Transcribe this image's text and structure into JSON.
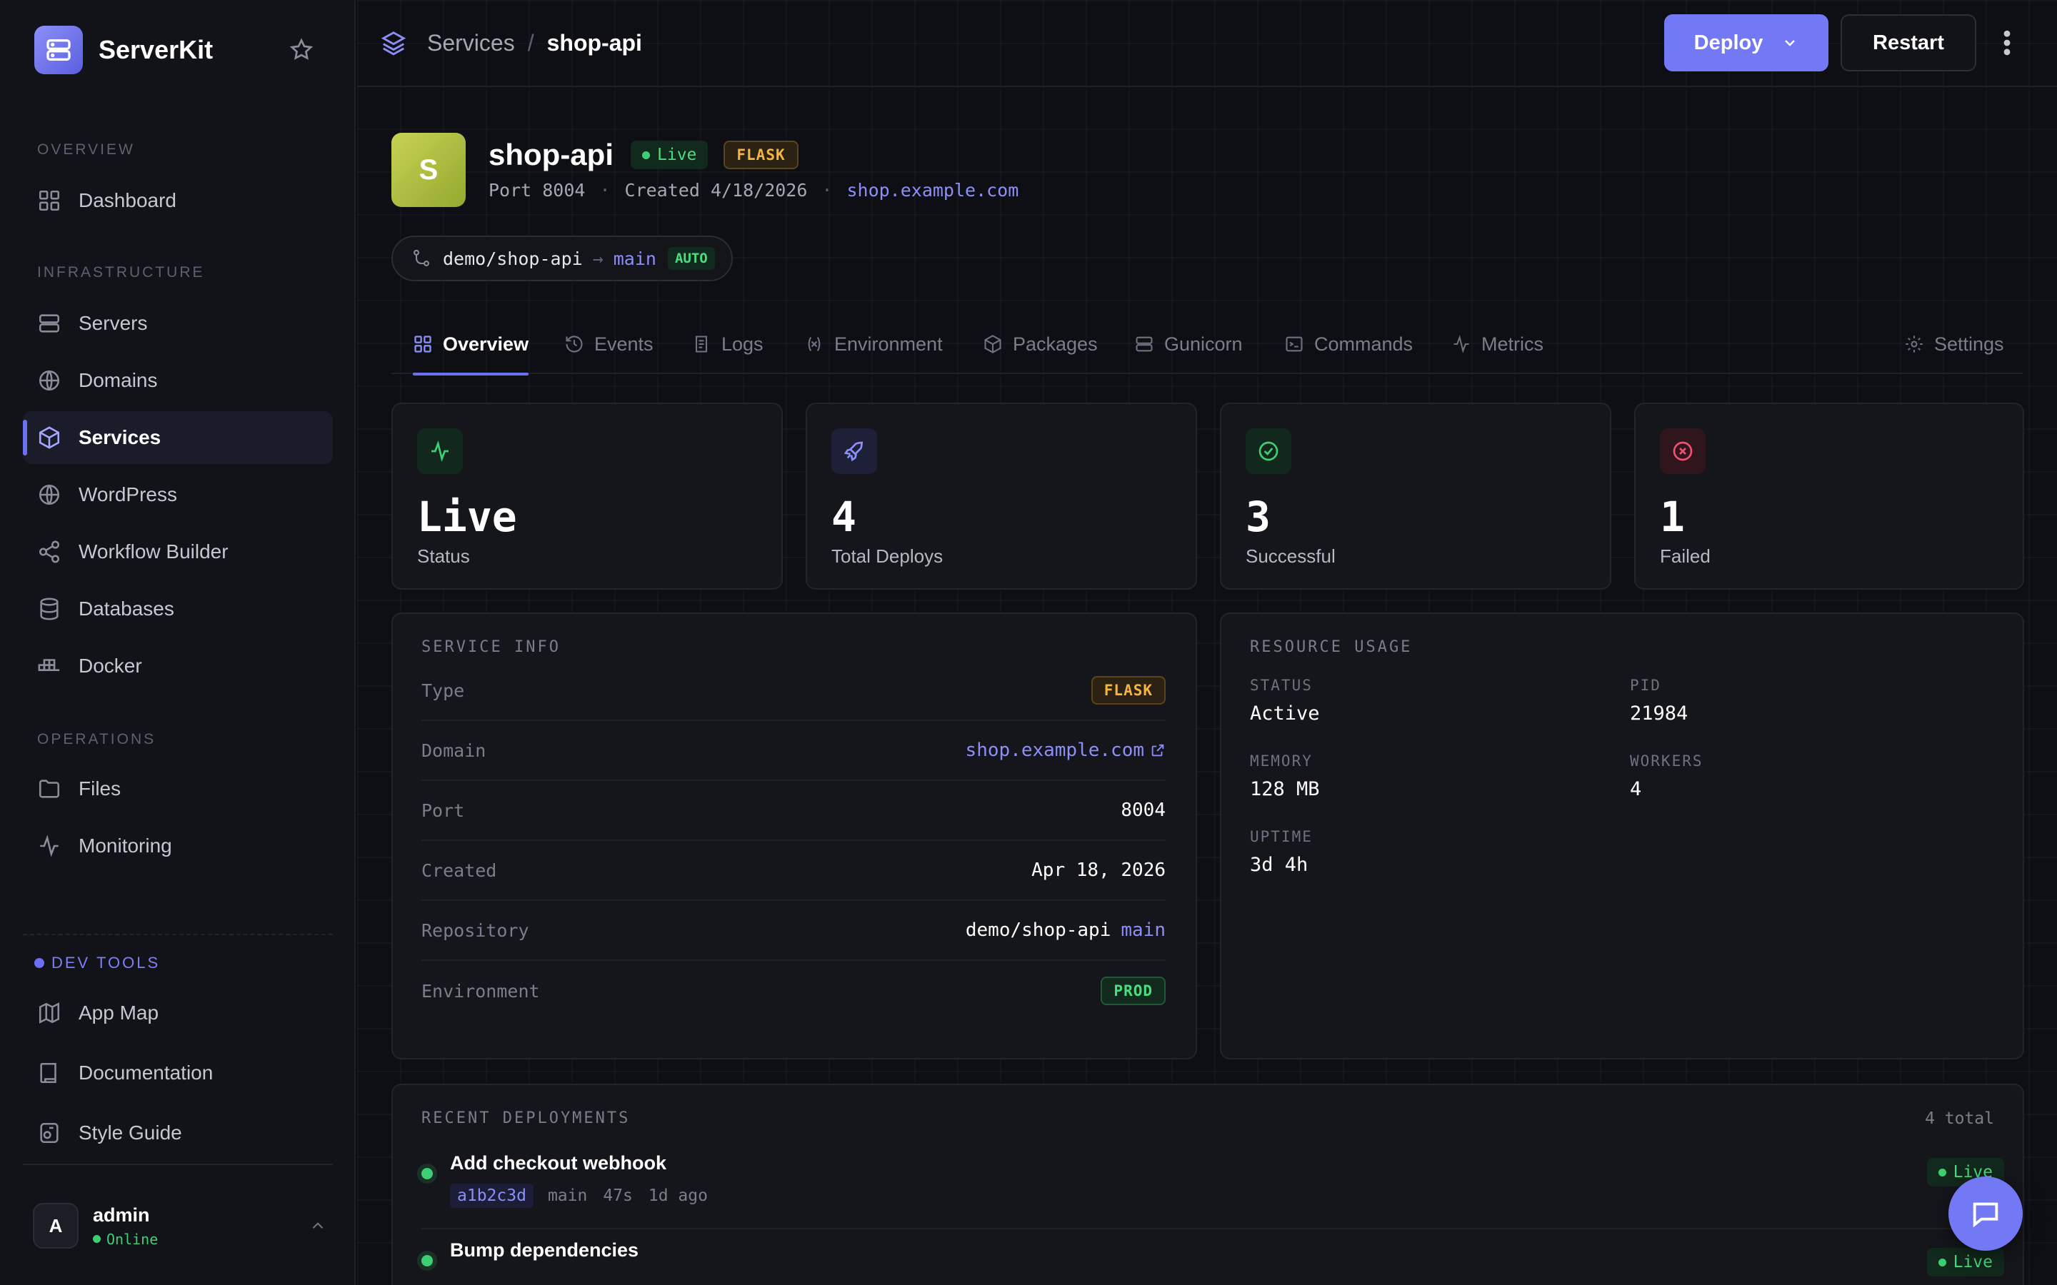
{
  "app": {
    "name": "ServerKit",
    "colors": {
      "accent": "#7378f5",
      "success": "#3ecf74",
      "warning": "#f5b544",
      "background": "#0d0e12"
    }
  },
  "sidebar": {
    "sections": [
      {
        "label": "OVERVIEW",
        "items": [
          {
            "label": "Dashboard",
            "icon": "dashboard-icon"
          }
        ]
      },
      {
        "label": "INFRASTRUCTURE",
        "items": [
          {
            "label": "Servers",
            "icon": "server-icon"
          },
          {
            "label": "Domains",
            "icon": "globe-icon"
          },
          {
            "label": "Services",
            "icon": "cube-icon",
            "active": true
          },
          {
            "label": "WordPress",
            "icon": "globe-icon"
          },
          {
            "label": "Workflow Builder",
            "icon": "share-nodes-icon"
          },
          {
            "label": "Databases",
            "icon": "database-icon"
          },
          {
            "label": "Docker",
            "icon": "containers-icon"
          }
        ]
      },
      {
        "label": "OPERATIONS",
        "items": [
          {
            "label": "Files",
            "icon": "folder-icon"
          },
          {
            "label": "Monitoring",
            "icon": "activity-icon"
          }
        ]
      }
    ],
    "dev_tools": {
      "label": "DEV TOOLS",
      "items": [
        {
          "label": "App Map",
          "icon": "map-icon"
        },
        {
          "label": "Documentation",
          "icon": "book-icon"
        },
        {
          "label": "Style Guide",
          "icon": "palette-icon"
        }
      ]
    },
    "user": {
      "initial": "A",
      "name": "admin",
      "status": "Online"
    }
  },
  "header": {
    "breadcrumb": [
      "Services",
      "shop-api"
    ],
    "separator": "/",
    "deploy_label": "Deploy",
    "restart_label": "Restart"
  },
  "service": {
    "initial": "S",
    "name": "shop-api",
    "status": "Live",
    "framework": "FLASK",
    "port": "Port 8004",
    "created": "Created 4/18/2026",
    "domain": "shop.example.com",
    "repo": "demo/shop-api",
    "arrow": "→",
    "branch": "main",
    "auto_label": "AUTO"
  },
  "tabs": [
    {
      "label": "Overview",
      "icon": "grid-icon",
      "active": true
    },
    {
      "label": "Events",
      "icon": "history-icon"
    },
    {
      "label": "Logs",
      "icon": "logs-icon"
    },
    {
      "label": "Environment",
      "icon": "variable-icon"
    },
    {
      "label": "Packages",
      "icon": "package-icon"
    },
    {
      "label": "Gunicorn",
      "icon": "server-icon"
    },
    {
      "label": "Commands",
      "icon": "terminal-icon"
    },
    {
      "label": "Metrics",
      "icon": "activity-icon"
    },
    {
      "label": "Settings",
      "icon": "gear-icon"
    }
  ],
  "stats": [
    {
      "value": "Live",
      "label": "Status",
      "icon": "activity-icon",
      "color": "#3ecf74"
    },
    {
      "value": "4",
      "label": "Total Deploys",
      "icon": "rocket-icon",
      "color": "#8b8ff7"
    },
    {
      "value": "3",
      "label": "Successful",
      "icon": "check-circle-icon",
      "color": "#3ecf74"
    },
    {
      "value": "1",
      "label": "Failed",
      "icon": "x-circle-icon",
      "color": "#f0506e"
    }
  ],
  "service_info": {
    "title": "SERVICE INFO",
    "rows": [
      {
        "key": "Type",
        "value": "FLASK"
      },
      {
        "key": "Domain",
        "value": "shop.example.com"
      },
      {
        "key": "Port",
        "value": "8004"
      },
      {
        "key": "Created",
        "value": "Apr 18, 2026"
      },
      {
        "key": "Repository",
        "value": "demo/shop-api",
        "branch": "main"
      },
      {
        "key": "Environment",
        "value": "PROD"
      }
    ]
  },
  "resource_usage": {
    "title": "RESOURCE USAGE",
    "items": [
      {
        "key": "STATUS",
        "value": "Active"
      },
      {
        "key": "PID",
        "value": "21984"
      },
      {
        "key": "MEMORY",
        "value": "128 MB"
      },
      {
        "key": "WORKERS",
        "value": "4"
      },
      {
        "key": "UPTIME",
        "value": "3d 4h"
      }
    ]
  },
  "deployments": {
    "title": "RECENT DEPLOYMENTS",
    "count": "4 total",
    "items": [
      {
        "title": "Add checkout webhook",
        "hash": "a1b2c3d",
        "branch": "main",
        "duration": "47s",
        "ago": "1d ago",
        "status": "Live"
      },
      {
        "title": "Bump dependencies",
        "status": "Live"
      }
    ]
  }
}
